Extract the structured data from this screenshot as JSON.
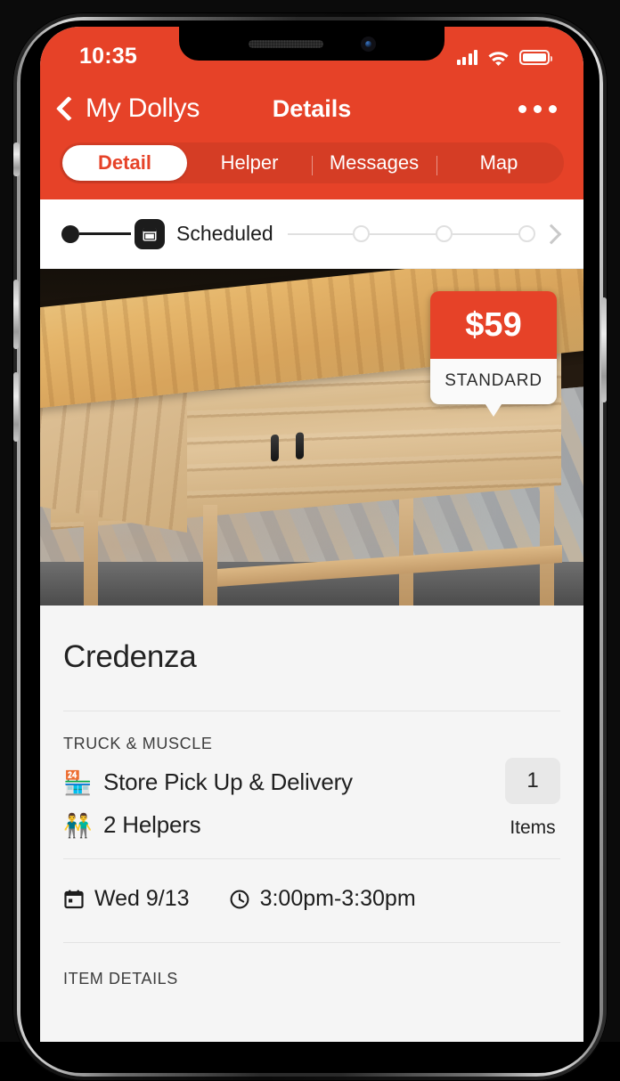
{
  "theme": {
    "brand": "#e64228",
    "screen_bg": "#f5f5f5",
    "dark": "#1c1c1c"
  },
  "status_bar": {
    "time": "10:35",
    "signal_icon": "signal-bars-icon",
    "wifi_icon": "wifi-icon",
    "battery_icon": "battery-full-icon"
  },
  "navbar": {
    "back_label": "My Dollys",
    "back_icon": "chevron-left-icon",
    "title": "Details",
    "more_icon": "more-horizontal-icon"
  },
  "tabs": [
    {
      "label": "Detail",
      "active": true
    },
    {
      "label": "Helper",
      "active": false
    },
    {
      "label": "Messages",
      "active": false
    },
    {
      "label": "Map",
      "active": false
    }
  ],
  "stepper": {
    "current_label": "Scheduled",
    "current_icon": "calendar-icon",
    "completed_steps": 1,
    "remaining_steps": 3,
    "next_icon": "chevron-right-icon"
  },
  "hero": {
    "image_alt": "wooden credenza sideboard",
    "price": "$59",
    "price_tier": "STANDARD"
  },
  "item": {
    "title": "Credenza"
  },
  "service": {
    "section_label": "TRUCK & MUSCLE",
    "rows": [
      {
        "icon": "storefront-icon",
        "emoji": "🏪",
        "label": "Store Pick Up & Delivery"
      },
      {
        "icon": "two-helpers-icon",
        "emoji": "👬",
        "label": "2 Helpers"
      }
    ],
    "items_count": "1",
    "items_label": "Items"
  },
  "schedule": {
    "date_icon": "calendar-icon",
    "date": "Wed 9/13",
    "time_icon": "clock-icon",
    "time": "3:00pm-3:30pm"
  },
  "item_details": {
    "section_label": "ITEM DETAILS"
  }
}
